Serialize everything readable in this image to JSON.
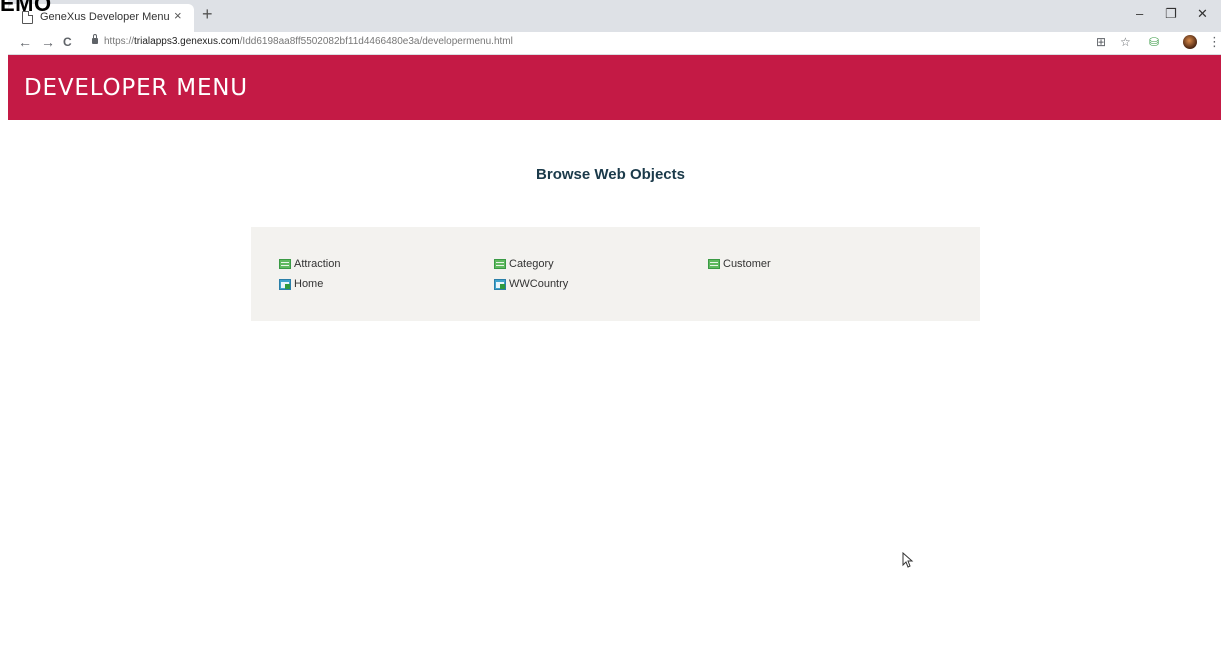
{
  "overlay": {
    "text": "EMO"
  },
  "browser": {
    "tab_title": "GeneXus Developer Menu",
    "tab_close": "×",
    "new_tab": "+",
    "window_controls": {
      "minimize": "–",
      "restore": "❐",
      "close": "✕"
    },
    "nav": {
      "back": "←",
      "forward": "→",
      "reload": "C"
    },
    "url_prefix": "https://",
    "url_host": "trialapps3.genexus.com",
    "url_path": "/Idd6198aa8ff5502082bf11d4466480e3a/developermenu.html",
    "toolbar_icons": [
      "translate-icon",
      "star-icon",
      "extension-icon",
      "avatar",
      "menu-icon"
    ]
  },
  "page": {
    "header_title": "DEVELOPER MENU",
    "section_title": "Browse Web Objects",
    "objects": [
      {
        "label": "Attraction",
        "icon": "transaction-icon"
      },
      {
        "label": "Category",
        "icon": "transaction-icon"
      },
      {
        "label": "Customer",
        "icon": "transaction-icon"
      },
      {
        "label": "Home",
        "icon": "webpanel-icon"
      },
      {
        "label": "WWCountry",
        "icon": "webpanel-icon"
      }
    ]
  },
  "colors": {
    "header": "#c41a45",
    "panel": "#f3f2ef",
    "section_title": "#1b3a4a"
  }
}
